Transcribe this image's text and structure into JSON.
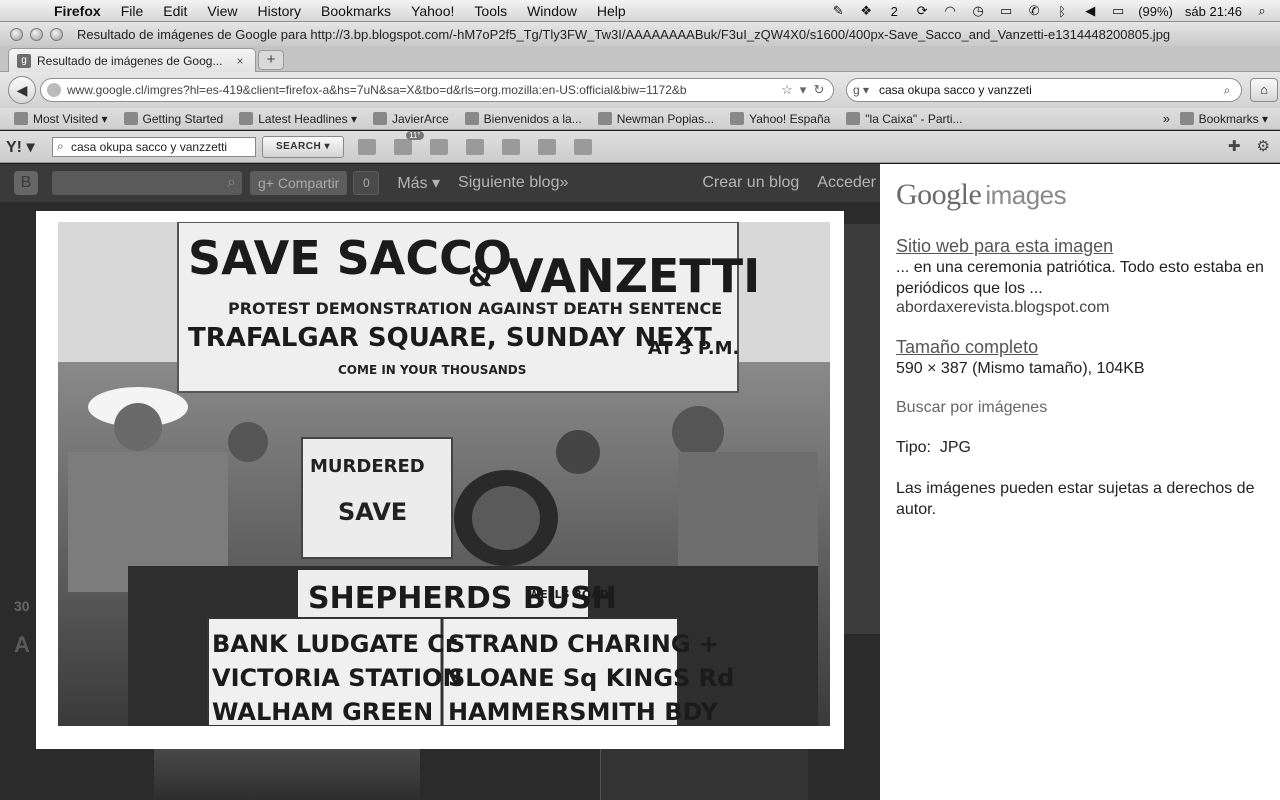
{
  "menubar": {
    "apple": "",
    "app_name": "Firefox",
    "items": [
      "File",
      "Edit",
      "View",
      "History",
      "Bookmarks",
      "Yahoo!",
      "Tools",
      "Window",
      "Help"
    ],
    "battery": "(99%)",
    "clock": "sáb 21:46",
    "extra_count": "2"
  },
  "window": {
    "title": "Resultado de imágenes de Google para http://3.bp.blogspot.com/-hM7oP2f5_Tg/Tly3FW_Tw3I/AAAAAAAABuk/F3uI_zQW4X0/s1600/400px-Save_Sacco_and_Vanzetti-e1314448200805.jpg"
  },
  "tabs": [
    {
      "label": "Resultado de imágenes de Goog...",
      "favicon": "g"
    }
  ],
  "newtab": "+",
  "nav": {
    "url": "www.google.cl/imgres?hl=es-419&client=firefox-a&hs=7uN&sa=X&tbo=d&rls=org.mozilla:en-US:official&biw=1172&b",
    "search_value": "casa okupa sacco y vanzzeti",
    "search_engine": "g"
  },
  "bookmarks": {
    "items": [
      "Most Visited",
      "Getting Started",
      "Latest Headlines",
      "JavierArce",
      "Bienvenidos a la...",
      "Newman Popias...",
      "Yahoo! España",
      "\"la Caixa\" - Parti..."
    ],
    "more": "»",
    "bookmarks_menu": "Bookmarks"
  },
  "yahoo_toolbar": {
    "logo": "Y!",
    "search_value": "casa okupa sacco y vanzzetti",
    "search_button": "SEARCH",
    "weather_badge": "11°"
  },
  "blog_bar": {
    "share": "Compartir",
    "share_count": "0",
    "more": "Más",
    "next_blog": "Siguiente blog»",
    "create_blog": "Crear un blog",
    "login": "Acceder"
  },
  "background": {
    "side_number": "30",
    "side_letter": "A"
  },
  "lightbox": {
    "close": "×",
    "photo_text": {
      "banner_line1": "SAVE SACCO",
      "banner_amp": "&",
      "banner_line1b": "VANZETTI",
      "banner_line2": "PROTEST DEMONSTRATION AGAINST DEATH SENTENCE",
      "banner_line3": "TRAFALGAR SQUARE, SUNDAY NEXT",
      "banner_time": "AT 3 P.M.",
      "banner_line4": "COME IN YOUR THOUSANDS",
      "placard1": "MURDERED",
      "placard2": "SAVE",
      "bus_route": "SHEPHERDS BUSH",
      "bus_route_small": "WELLS ROAD",
      "bus_row1_left": "BANK  LUDGATE Cr",
      "bus_row1_right": "STRAND CHARING +",
      "bus_row2_left": "VICTORIA  STATION",
      "bus_row2_right": "SLOANE Sq KINGS Rd",
      "bus_row3_left": "WALHAM  GREEN",
      "bus_row3_right": "HAMMERSMITH  BDY"
    }
  },
  "google_panel": {
    "logo_google": "Google",
    "logo_images": "images",
    "site_link": "Sitio web para esta imagen",
    "snippet": "... en una ceremonia patriótica. Todo esto estaba en periódicos que los ...",
    "site_domain": "abordaxerevista.blogspot.com",
    "full_size_link": "Tamaño completo",
    "dimensions": "590 × 387 (Mismo tamaño), 104KB",
    "search_by_image": "Buscar por imágenes",
    "type_label": "Tipo:",
    "type_value": "JPG",
    "copyright": "Las imágenes pueden estar sujetas a derechos de autor."
  }
}
